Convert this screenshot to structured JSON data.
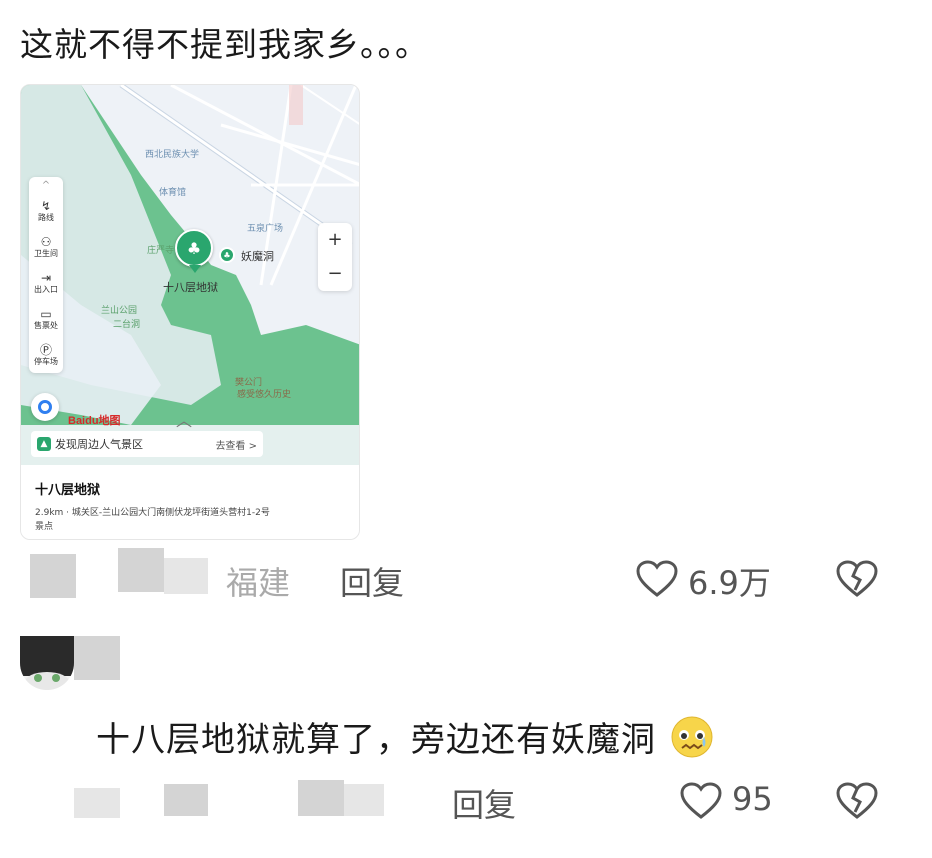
{
  "post": {
    "text": "这就不得不提到我家乡。。。"
  },
  "map_card": {
    "toolbar": [
      {
        "label": "路线",
        "icon": "route-icon"
      },
      {
        "label": "卫生间",
        "icon": "restroom-icon"
      },
      {
        "label": "出入口",
        "icon": "entrance-icon"
      },
      {
        "label": "售票处",
        "icon": "ticket-icon"
      },
      {
        "label": "停车场",
        "icon": "parking-icon"
      }
    ],
    "zoom_in": "+",
    "zoom_out": "−",
    "labels": {
      "university": "西北民族大学",
      "stadium": "体育馆",
      "plaza": "五泉广场",
      "temple": "庄严寺",
      "lanshan_park": "兰山公园",
      "ertai_cave": "二台洞",
      "gate": "樊公门",
      "gate_sub": "感受悠久历史"
    },
    "pin_label": "十八层地狱",
    "nearby_poi": "妖魔洞",
    "baidu_logo": "Baidu地图",
    "nearby_bar": {
      "text": "发现周边人气景区",
      "action": "去查看 >"
    },
    "poi": {
      "title": "十八层地狱",
      "address": "2.9km · 城关区-兰山公园大门南侧伏龙坪街道头营村1-2号",
      "category": "景点"
    }
  },
  "comment_meta": {
    "location": "福建",
    "reply": "回复",
    "likes": "6.9万"
  },
  "reply_comment": {
    "text": "十八层地狱就算了，旁边还有妖魔洞",
    "reply": "回复",
    "likes": "95"
  },
  "colors": {
    "park_green": "#6cc28f",
    "pin_green": "#2aa66e",
    "water": "#e3edf5"
  }
}
